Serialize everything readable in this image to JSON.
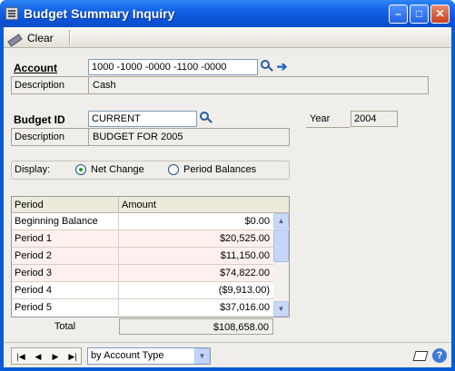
{
  "window": {
    "title": "Budget Summary Inquiry"
  },
  "toolbar": {
    "clear_label": "Clear"
  },
  "account": {
    "label": "Account",
    "value": "1000 -1000 -0000 -1100 -0000",
    "description_label": "Description",
    "description": "Cash"
  },
  "budget": {
    "label": "Budget ID",
    "value": "CURRENT",
    "description_label": "Description",
    "description": "BUDGET FOR 2005",
    "year_label": "Year",
    "year": "2004"
  },
  "display": {
    "label": "Display:",
    "options": [
      "Net Change",
      "Period Balances"
    ],
    "selected": "Net Change"
  },
  "grid": {
    "headers": [
      "Period",
      "Amount"
    ],
    "rows": [
      {
        "period": "Beginning Balance",
        "amount": "$0.00"
      },
      {
        "period": "Period 1",
        "amount": "$20,525.00"
      },
      {
        "period": "Period 2",
        "amount": "$11,150.00"
      },
      {
        "period": "Period 3",
        "amount": "$74,822.00"
      },
      {
        "period": "Period 4",
        "amount": "($9,913.00)"
      },
      {
        "period": "Period 5",
        "amount": "$37,016.00"
      }
    ],
    "total_label": "Total",
    "total": "$108,658.00"
  },
  "statusbar": {
    "sort_value": "by Account Type"
  },
  "icons": {
    "clear": "eraser-icon",
    "lookup": "magnifier-icon",
    "expand": "arrow-right-icon",
    "note": "note-icon",
    "help": "help-icon"
  }
}
